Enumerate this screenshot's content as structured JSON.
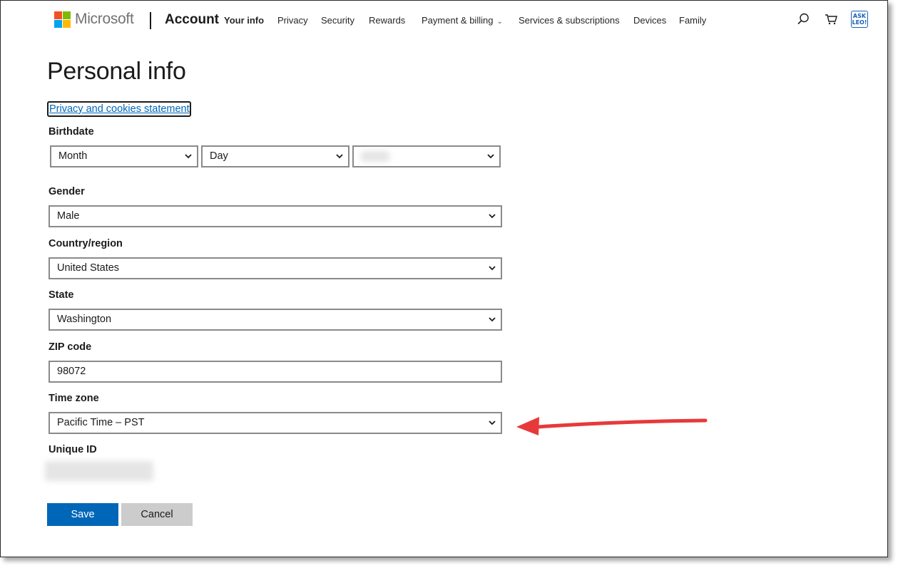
{
  "header": {
    "brand": "Microsoft",
    "section": "Account",
    "nav": [
      {
        "label": "Your info",
        "active": true
      },
      {
        "label": "Privacy"
      },
      {
        "label": "Security"
      },
      {
        "label": "Rewards"
      },
      {
        "label": "Payment & billing",
        "has_dropdown": true
      },
      {
        "label": "Services & subscriptions"
      },
      {
        "label": "Devices"
      },
      {
        "label": "Family"
      }
    ],
    "icons": [
      "search-icon",
      "cart-icon",
      "ask-leo-badge"
    ],
    "badge_text": [
      "ASK",
      "LEO!"
    ]
  },
  "page": {
    "title": "Personal info",
    "privacy_link": "Privacy and cookies statement"
  },
  "form": {
    "birthdate": {
      "label": "Birthdate",
      "month": "Month",
      "day": "Day"
    },
    "gender": {
      "label": "Gender",
      "value": "Male"
    },
    "country": {
      "label": "Country/region",
      "value": "United States"
    },
    "state": {
      "label": "State",
      "value": "Washington"
    },
    "zip": {
      "label": "ZIP code",
      "value": "98072"
    },
    "timezone": {
      "label": "Time zone",
      "value": "Pacific Time – PST"
    },
    "unique_id": {
      "label": "Unique ID"
    }
  },
  "buttons": {
    "save": "Save",
    "cancel": "Cancel"
  },
  "colors": {
    "accent": "#0067b8",
    "annotation_arrow": "#e8393a"
  }
}
